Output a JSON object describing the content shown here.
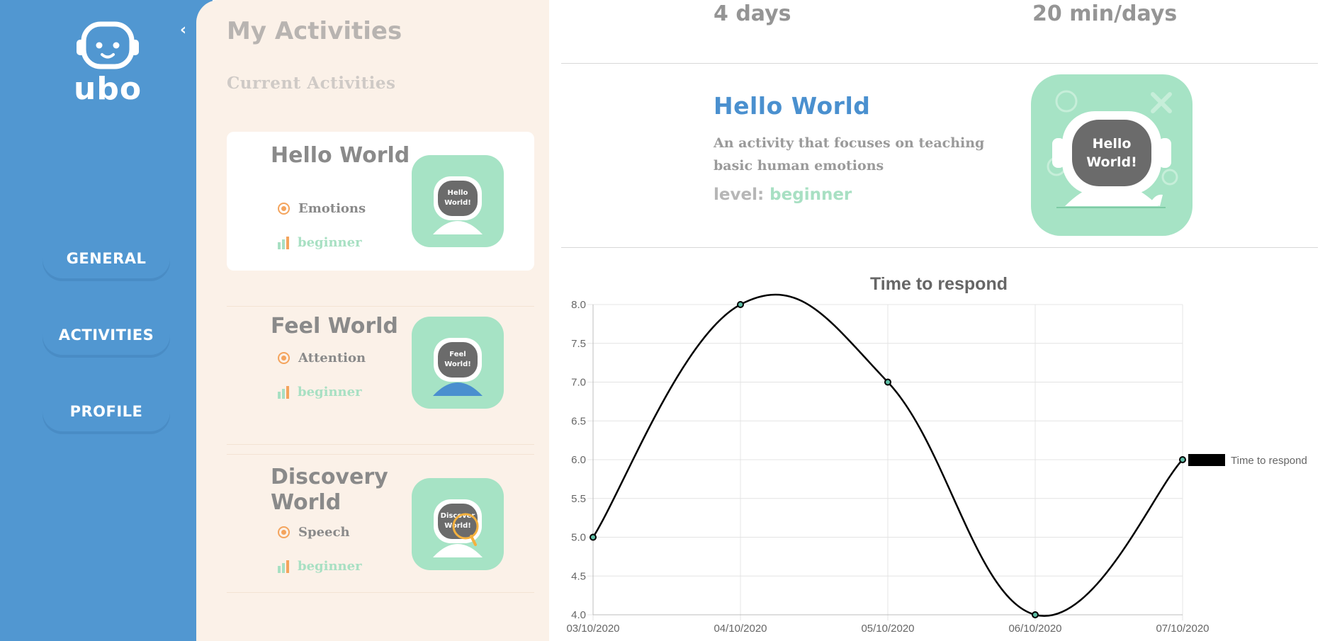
{
  "brand": {
    "logo_text": "ubo"
  },
  "nav": {
    "items": [
      {
        "label": "GENERAL"
      },
      {
        "label": "ACTIVITIES"
      },
      {
        "label": "PROFILE"
      }
    ]
  },
  "activities": {
    "title": "My Activities",
    "subtitle": "Current Activities",
    "cards": [
      {
        "title": "Hello World",
        "tag": "Emotions",
        "level": "beginner",
        "thumb_text": "Hello World!"
      },
      {
        "title": "Feel World",
        "tag": "Attention",
        "level": "beginner",
        "thumb_text": "Feel World!"
      },
      {
        "title": "Discovery World",
        "tag": "Speech",
        "level": "beginner",
        "thumb_text": "Discover World!"
      }
    ]
  },
  "stats": {
    "days": "4 days",
    "duration": "20 min/days"
  },
  "detail": {
    "title": "Hello World",
    "description": "An activity that focuses on teaching basic human emotions",
    "level_label": "level:",
    "level_value": "beginner",
    "image_text": "Hello World!"
  },
  "colors": {
    "sidebar": "#5197d1",
    "panel": "#fbf1e8",
    "mint": "#a8e0c3",
    "accent_orange": "#f4a45d",
    "title_blue": "#4a90cf"
  },
  "chart_data": {
    "type": "line",
    "title": "Time to respond",
    "x": [
      "03/10/2020",
      "04/10/2020",
      "05/10/2020",
      "06/10/2020",
      "07/10/2020"
    ],
    "series": [
      {
        "name": "Time to respond",
        "values": [
          5.0,
          8.0,
          7.0,
          4.0,
          6.0
        ],
        "color": "#000000"
      }
    ],
    "y_ticks": [
      "8.0",
      "7.5",
      "7.0",
      "6.5",
      "6.0",
      "5.5",
      "5.0",
      "4.5",
      "4.0"
    ],
    "ylim": [
      4.0,
      8.0
    ],
    "grid": true,
    "legend": "right"
  }
}
